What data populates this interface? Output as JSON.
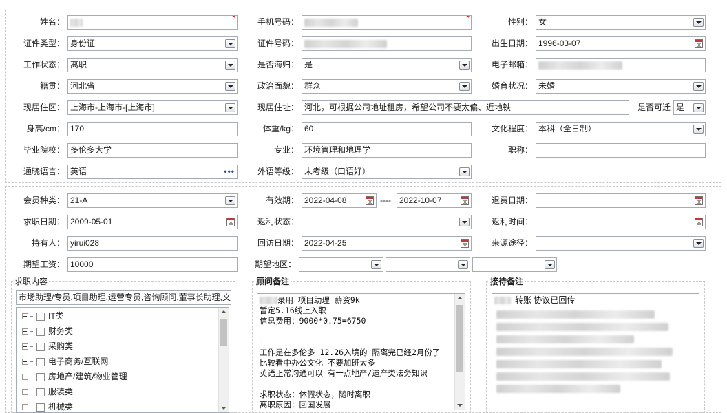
{
  "basic": {
    "name_label": "姓名：",
    "mobile_label": "手机号码：",
    "gender_label": "性别：",
    "gender": "女",
    "id_type_label": "证件类型：",
    "id_type": "身份证",
    "id_no_label": "证件号码：",
    "birth_label": "出生日期：",
    "birth": "1996-03-07",
    "work_status_label": "工作状态：",
    "work_status": "离职",
    "returnee_label": "是否海归：",
    "returnee": "是",
    "email_label": "电子邮箱：",
    "native_label": "籍贯：",
    "native": "河北省",
    "political_label": "政治面貌：",
    "political": "群众",
    "marital_label": "婚育状况：",
    "marital": "未婚",
    "residence_label": "现居住区：",
    "residence": "上海市-上海市-[上海市]",
    "address_label": "现居住址：",
    "address": "河北，可根据公司地址租房，希望公司不要太偏、近地铁",
    "movable_label": "是否可迁",
    "movable": "是",
    "height_label": "身高/cm：",
    "height": "170",
    "weight_label": "体重/kg：",
    "weight": "60",
    "education_label": "文化程度：",
    "education": "本科（全日制）",
    "school_label": "毕业院校：",
    "school": "多伦多大学",
    "major_label": "专业：",
    "major": "环境管理和地理学",
    "title_label": "职称：",
    "title": "",
    "language_label": "通晓语言：",
    "language": "英语",
    "fl_level_label": "外语等级：",
    "fl_level": "未考级（口语好）"
  },
  "membership": {
    "member_type_label": "会员种类：",
    "member_type": "21-A",
    "valid_label": "有效期：",
    "valid_from": "2022-04-08",
    "valid_sep": "----",
    "valid_to": "2022-10-07",
    "refund_date_label": "退费日期：",
    "refund_date": "",
    "job_date_label": "求职日期：",
    "job_date": "2009-05-01",
    "rebate_status_label": "返利状态：",
    "rebate_status": "",
    "rebate_time_label": "返利时间：",
    "rebate_time": "",
    "holder_label": "持有人：",
    "holder": "yirui028",
    "visit_date_label": "回访日期：",
    "visit_date": "2022-04-25",
    "source_label": "来源途径：",
    "source": "",
    "salary_label": "期望工资：",
    "salary": "10000",
    "region_label": "期望地区："
  },
  "job_content": {
    "title": "求职内容",
    "summary": "市场助理/专员,项目助理,运营专员,咨询顾问,董事长助理,文",
    "categories": [
      "IT类",
      "财务类",
      "采购类",
      "电子商务/互联网",
      "房地产/建筑/物业管理",
      "服装类",
      "机械类"
    ]
  },
  "advisor_notes": {
    "title": "顾问备注",
    "lines": [
      "录用 项目助理  薪资9k",
      "暂定5.16线上入职",
      "信息费用：9000*0.75=6750",
      "",
      "|",
      "工作是在多伦多  12.26入境的  隔离完已经2月份了",
      "比较看中办公文化 不要加班太多",
      "英语正常沟通可以 有一点地产/遗产类法务知识",
      "",
      "求职状态：休假状态，随时离职",
      "离职原因：回国发展"
    ]
  },
  "reception_notes": {
    "title": "接待备注",
    "line1": "转账 协议已回传"
  },
  "colors": {
    "required": "#dd0000",
    "border": "#a5acb5",
    "section_border": "#c9c9c9"
  },
  "icons": [
    "dropdown-arrow-icon",
    "calendar-icon",
    "more-dots-icon",
    "tree-expand-icon",
    "checkbox-icon",
    "scroll-arrow-icon"
  ]
}
